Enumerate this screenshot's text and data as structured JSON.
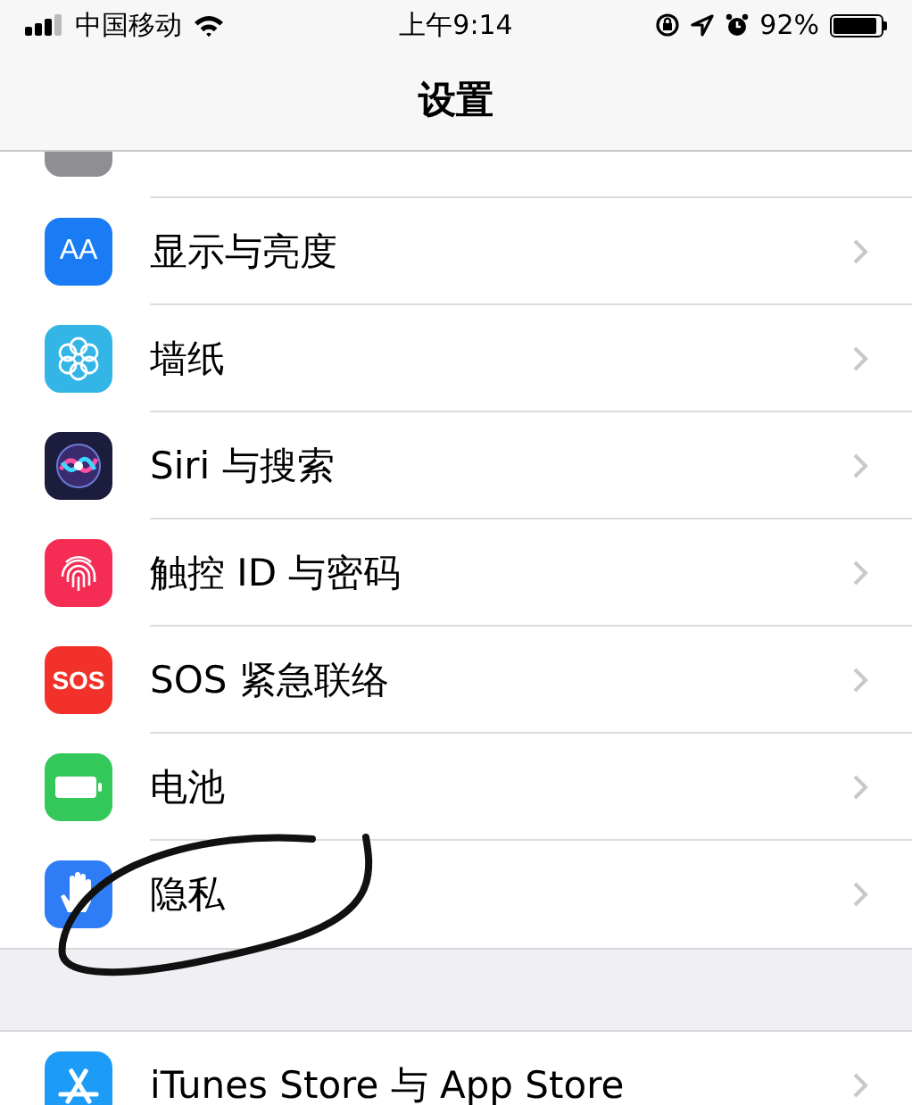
{
  "status_bar": {
    "carrier": "中国移动",
    "time": "上午9:14",
    "battery_text": "92%",
    "battery": {
      "level": 0.92
    }
  },
  "nav": {
    "title": "设置"
  },
  "groups": [
    {
      "rows": [
        {
          "kind": "control",
          "label": ""
        },
        {
          "kind": "display",
          "label": "显示与亮度",
          "icon_text": "AA"
        },
        {
          "kind": "wallpaper",
          "label": "墙纸"
        },
        {
          "kind": "siri",
          "label": "Siri 与搜索"
        },
        {
          "kind": "touchid",
          "label": "触控 ID 与密码"
        },
        {
          "kind": "sos",
          "label": "SOS 紧急联络",
          "icon_text": "SOS"
        },
        {
          "kind": "battery",
          "label": "电池"
        },
        {
          "kind": "privacy",
          "label": "隐私"
        }
      ]
    },
    {
      "rows": [
        {
          "kind": "appstore",
          "label": "iTunes Store 与 App Store"
        }
      ]
    }
  ]
}
